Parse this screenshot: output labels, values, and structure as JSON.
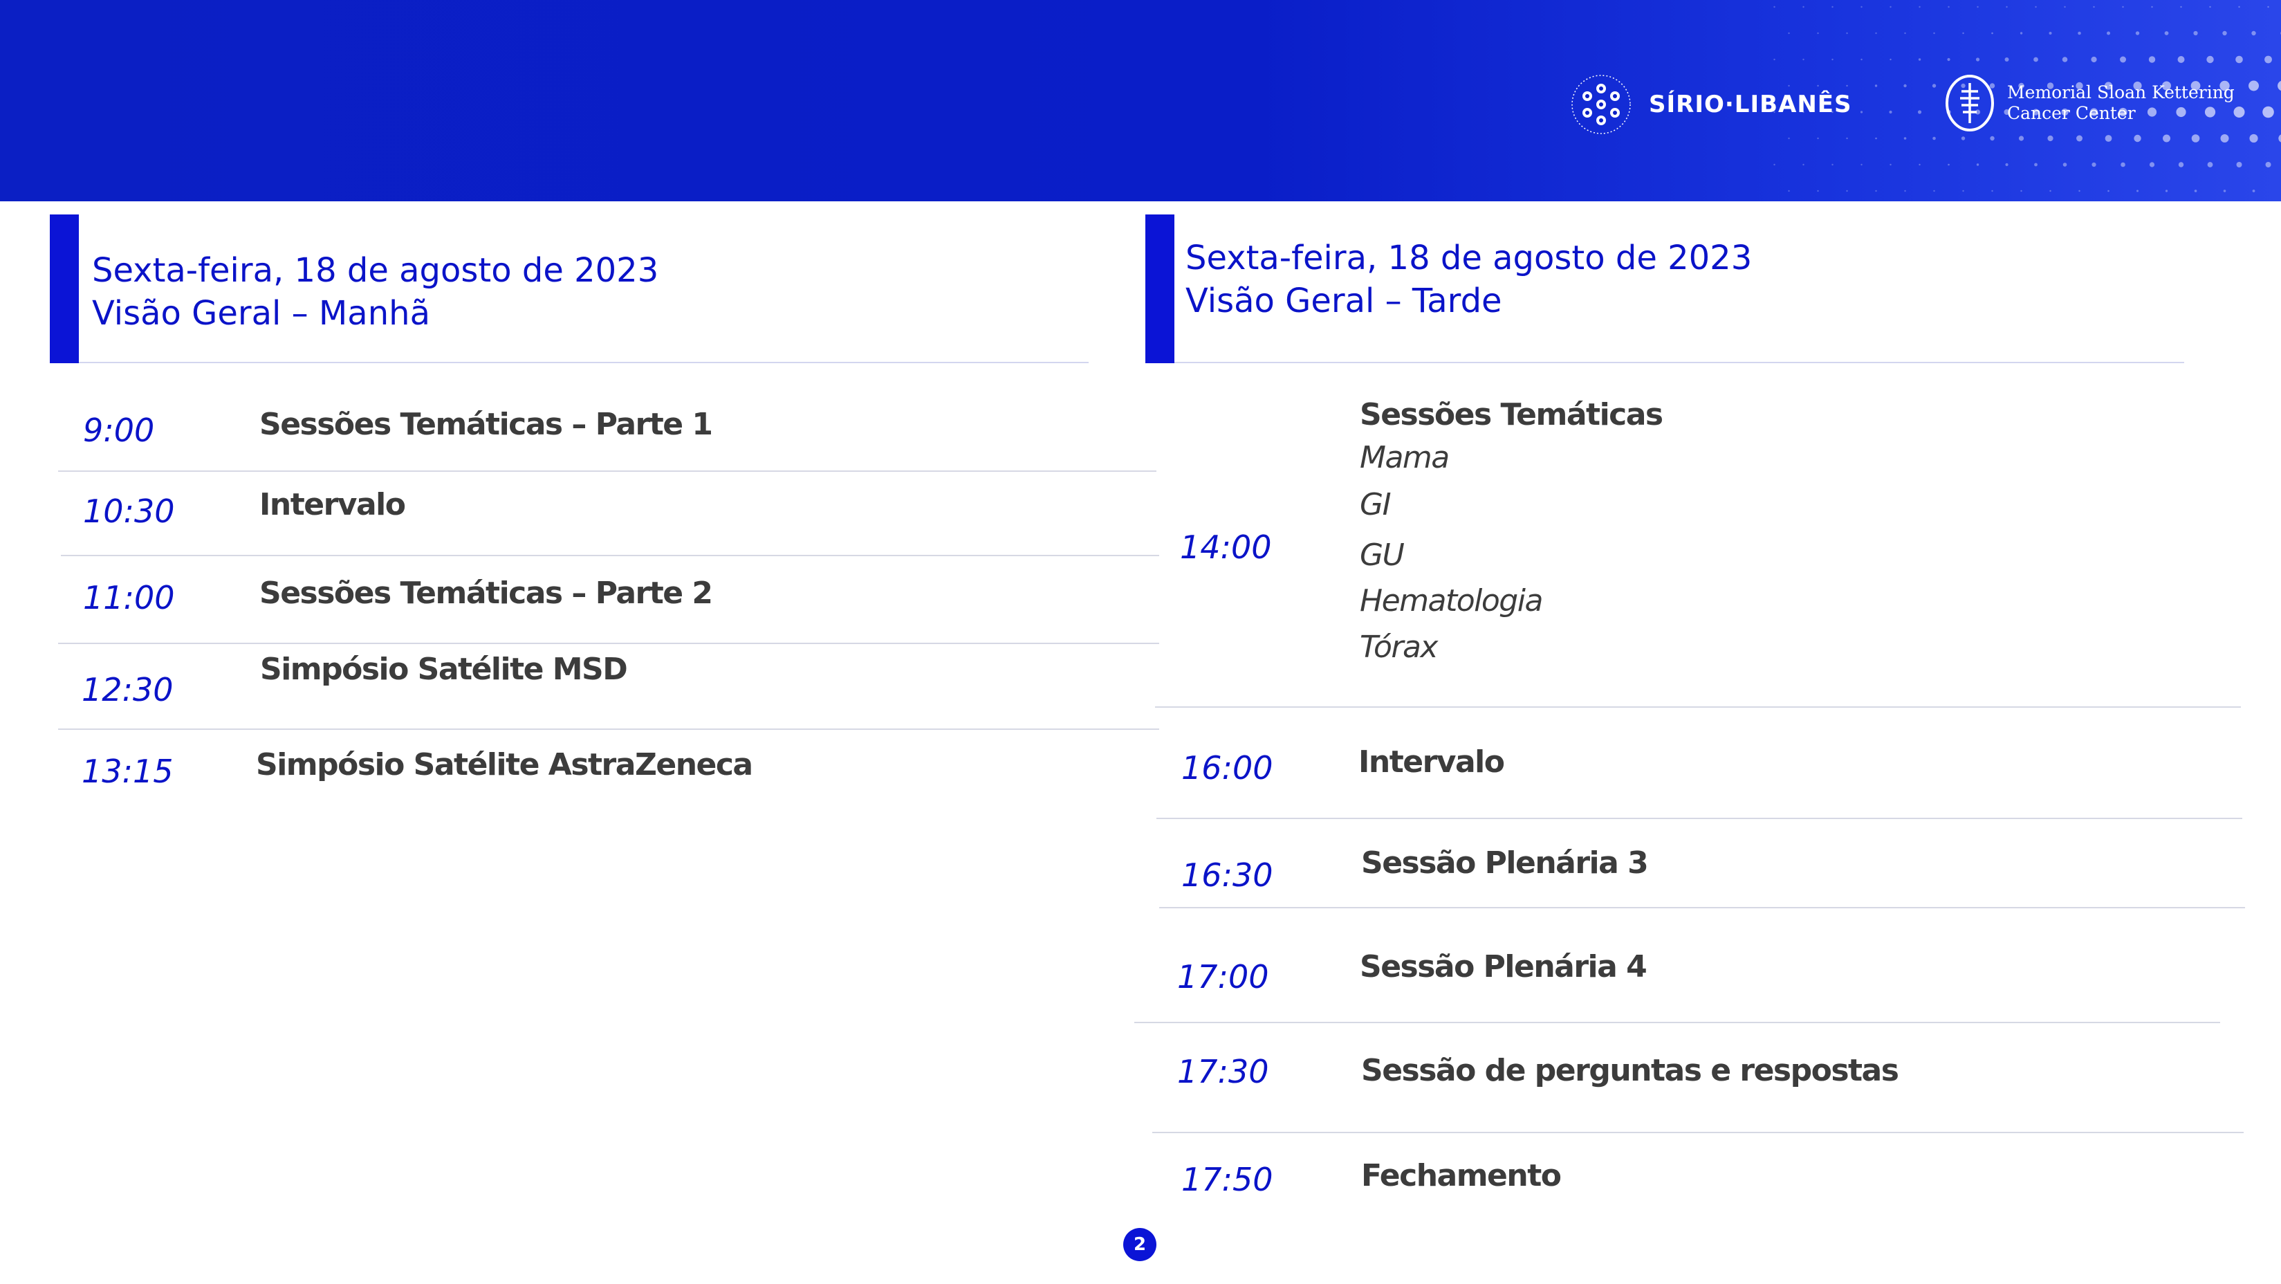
{
  "header": {
    "logo_sirio": {
      "name": "SÍRIO·LIBANÊS",
      "icon": "sirio-libanes-emblem-icon"
    },
    "logo_msk": {
      "line1": "Memorial Sloan Kettering",
      "line2": "Cancer Center",
      "icon": "msk-emblem-icon"
    },
    "colors": {
      "background": "#0b1fc4",
      "accent": "#0b14d6"
    }
  },
  "morning": {
    "date": "Sexta-feira, 18 de agosto de 2023",
    "subtitle": "Visão Geral – Manhã",
    "rows": [
      {
        "time": "9:00",
        "title": "Sessões Temáticas – Parte 1"
      },
      {
        "time": "10:30",
        "title": "Intervalo"
      },
      {
        "time": "11:00",
        "title": "Sessões Temáticas – Parte 2"
      },
      {
        "time": "12:30",
        "title": "Simpósio Satélite MSD"
      },
      {
        "time": "13:15",
        "title": "Simpósio Satélite AstraZeneca"
      }
    ]
  },
  "afternoon": {
    "date": "Sexta-feira, 18 de agosto de 2023",
    "subtitle": "Visão Geral – Tarde",
    "rows": [
      {
        "time": "14:00",
        "title": "Sessões Temáticas",
        "subitems": [
          "Mama",
          "GI",
          "GU",
          "Hematologia",
          "Tórax"
        ]
      },
      {
        "time": "16:00",
        "title": "Intervalo"
      },
      {
        "time": "16:30",
        "title": "Sessão Plenária 3"
      },
      {
        "time": "17:00",
        "title": "Sessão Plenária 4"
      },
      {
        "time": "17:30",
        "title": "Sessão de perguntas e respostas"
      },
      {
        "time": "17:50",
        "title": "Fechamento"
      }
    ]
  },
  "page_number": "2"
}
